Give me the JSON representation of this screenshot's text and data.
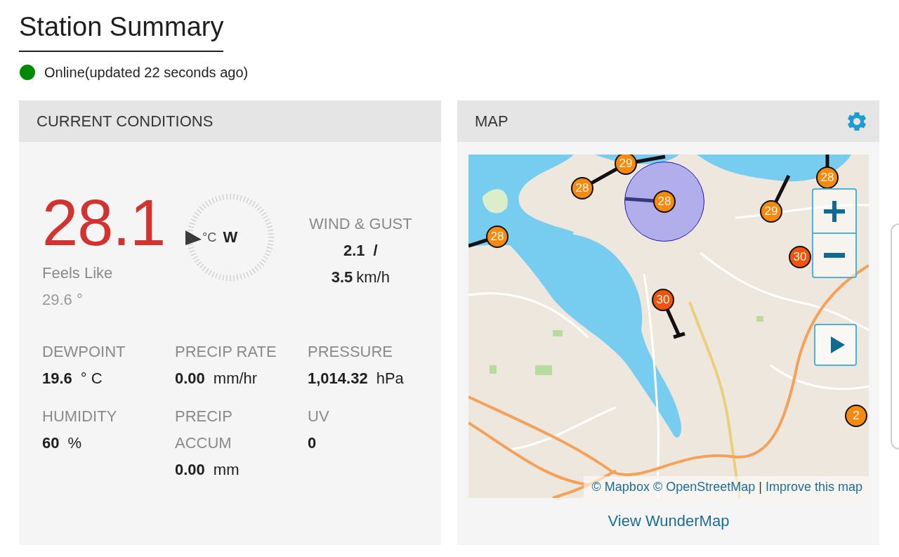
{
  "page": {
    "title": "Station Summary"
  },
  "status": {
    "text": "Online(updated 22 seconds ago)",
    "color": "#008a00"
  },
  "current_conditions": {
    "title": "CURRENT CONDITIONS",
    "temperature": {
      "value": "28.1",
      "unit": "°C"
    },
    "feels_like": {
      "label": "Feels Like",
      "value": "29.6 °"
    },
    "compass": {
      "direction": "W"
    },
    "wind": {
      "label": "WIND & GUST",
      "speed": "2.1",
      "separator": "/",
      "gust": "3.5",
      "unit": "km/h"
    },
    "stats": [
      {
        "label": "DEWPOINT",
        "value": "19.6",
        "unit": "° C"
      },
      {
        "label": "PRECIP RATE",
        "value": "0.00",
        "unit": "mm/hr"
      },
      {
        "label": "PRESSURE",
        "value": "1,014.32",
        "unit": "hPa"
      },
      {
        "label": "HUMIDITY",
        "value": "60",
        "unit": "%"
      },
      {
        "label": "PRECIP ACCUM",
        "value": "0.00",
        "unit": "mm"
      },
      {
        "label": "UV",
        "value": "0"
      }
    ]
  },
  "map": {
    "title": "MAP",
    "markers": [
      {
        "label": "29",
        "color": "#f8890f",
        "selected": false
      },
      {
        "label": "28",
        "color": "#f8890f",
        "selected": false
      },
      {
        "label": "28",
        "color": "#f8890f",
        "selected": false
      },
      {
        "label": "28",
        "color": "#f8890f",
        "selected": true
      },
      {
        "label": "29",
        "color": "#f8890f",
        "selected": false
      },
      {
        "label": "28",
        "color": "#f8890f",
        "selected": false
      },
      {
        "label": "30",
        "color": "#f0540c",
        "selected": false
      },
      {
        "label": "30",
        "color": "#f0540c",
        "selected": false
      },
      {
        "label": "2",
        "color": "#f8890f",
        "selected": false
      }
    ],
    "attribution": [
      {
        "kind": "link",
        "text": "© Mapbox"
      },
      {
        "kind": "link",
        "text": "© OpenStreetMap"
      },
      {
        "kind": "separator",
        "text": "|"
      },
      {
        "kind": "link",
        "text": "Improve this map"
      }
    ],
    "link": "View WunderMap"
  }
}
